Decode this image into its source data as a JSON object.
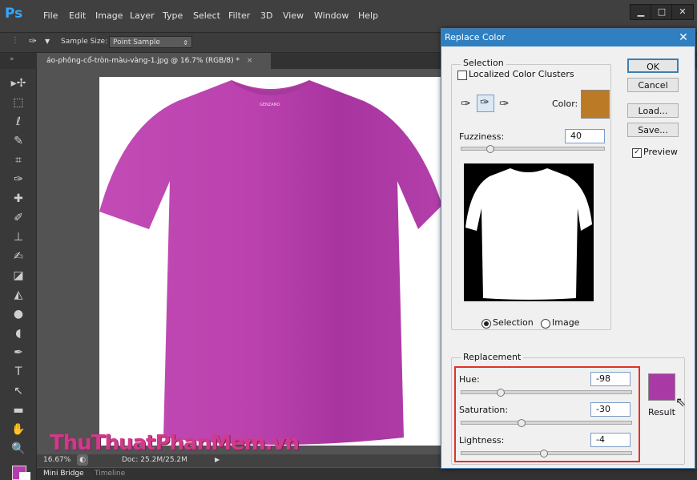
{
  "app": {
    "logo": "Ps",
    "menus": [
      "File",
      "Edit",
      "Image",
      "Layer",
      "Type",
      "Select",
      "Filter",
      "3D",
      "View",
      "Window",
      "Help"
    ]
  },
  "options_bar": {
    "sample_size_label": "Sample Size:",
    "sample_size_value": "Point Sample"
  },
  "document": {
    "tab_label": "áo-phông-cổ-tròn-màu-vàng-1.jpg @ 16.7% (RGB/8) *",
    "tab_close": "×",
    "shirt_color": "#b63dac",
    "zoom": "16.67%",
    "doc_size": "Doc: 25.2M/25.2M",
    "shirt_brand": "GENZANO"
  },
  "bottom_panels": [
    "Mini Bridge",
    "Timeline"
  ],
  "watermark": "ThuThuatPhanMem.vn",
  "dialog": {
    "title": "Replace Color",
    "selection_group": "Selection",
    "localized_label": "Localized Color Clusters",
    "localized_checked": false,
    "color_label": "Color:",
    "color_swatch": "#bb7a25",
    "fuzziness_label": "Fuzziness:",
    "fuzziness_value": "40",
    "fuzziness_level": 0.2,
    "radio_selection": "Selection",
    "radio_image": "Image",
    "selected_view": "Selection",
    "buttons": {
      "ok": "OK",
      "cancel": "Cancel",
      "load": "Load...",
      "save": "Save..."
    },
    "preview_label": "Preview",
    "preview_checked": true,
    "replacement_group": "Replacement",
    "hue_label": "Hue:",
    "hue_value": "-98",
    "saturation_label": "Saturation:",
    "saturation_value": "-30",
    "lightness_label": "Lightness:",
    "lightness_value": "-4",
    "result_label": "Result",
    "result_color": "#a93aa5"
  }
}
